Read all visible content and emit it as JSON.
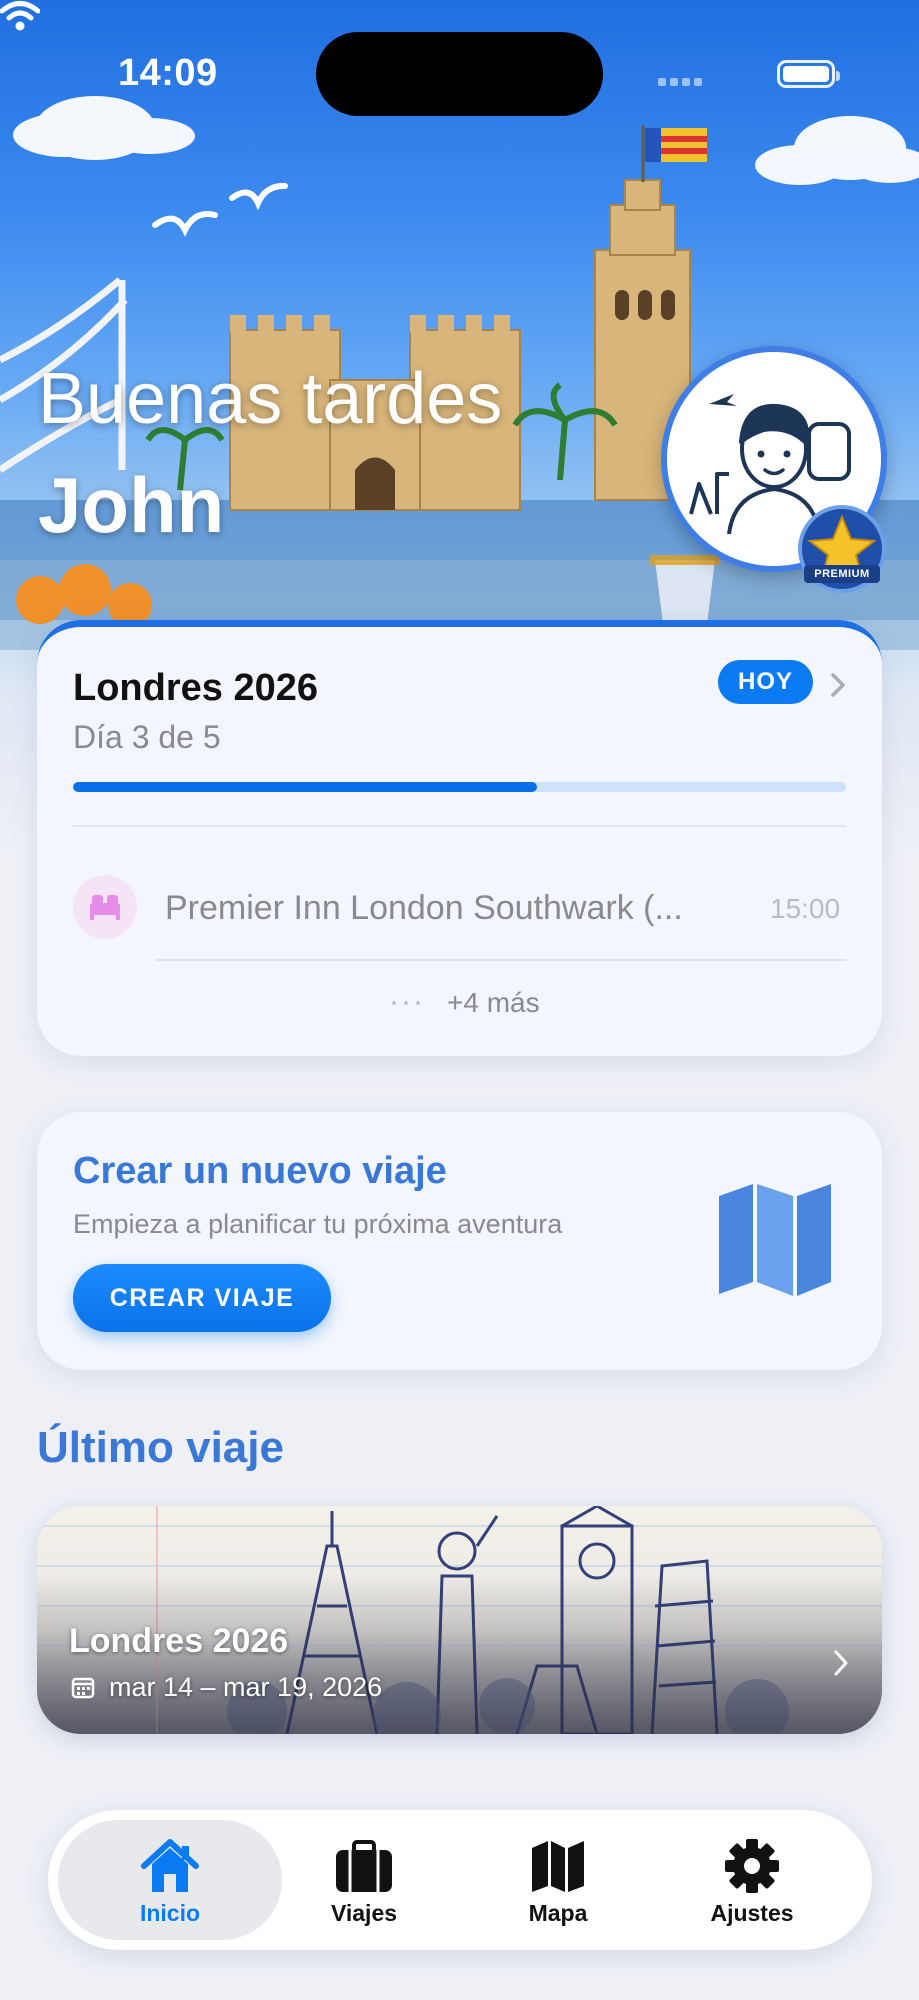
{
  "status_bar": {
    "time": "14:09"
  },
  "hero": {
    "greeting": "Buenas tardes",
    "user_name": "John",
    "badge_label": "PREMIUM"
  },
  "current_trip": {
    "title": "Londres 2026",
    "day_text": "Día 3 de 5",
    "badge": "HOY",
    "progress": 0.6,
    "next_event": {
      "icon": "bed-icon",
      "name": "Premier Inn London Southwark (...",
      "time": "15:00"
    },
    "more_label": "+4 más"
  },
  "create_trip": {
    "title": "Crear un nuevo viaje",
    "subtitle": "Empieza a planificar tu próxima aventura",
    "button_label": "CREAR VIAJE"
  },
  "last_trip": {
    "section_title": "Último viaje",
    "name": "Londres 2026",
    "dates": "mar 14 – mar 19, 2026"
  },
  "tabbar": {
    "items": [
      {
        "label": "Inicio",
        "icon": "house-icon",
        "active": true
      },
      {
        "label": "Viajes",
        "icon": "suitcase-icon",
        "active": false
      },
      {
        "label": "Mapa",
        "icon": "map-icon",
        "active": false
      },
      {
        "label": "Ajustes",
        "icon": "gear-icon",
        "active": false
      }
    ]
  },
  "colors": {
    "accent": "#0a7bf2",
    "title_blue": "#3a78d8",
    "progress": "#0a6fe9",
    "background": "#eef0f6"
  }
}
